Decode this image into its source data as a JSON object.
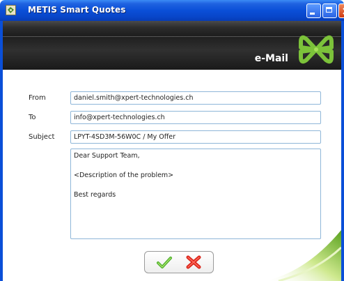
{
  "window": {
    "title": "METIS Smart Quotes"
  },
  "header": {
    "title": "e-Mail"
  },
  "form": {
    "from_label": "From",
    "from_value": "daniel.smith@xpert-technologies.ch",
    "to_label": "To",
    "to_value": "info@xpert-technologies.ch",
    "subject_label": "Subject",
    "subject_value": "LPYT-4SD3M-56W0C / My Offer",
    "body_lines": [
      "Dear Support Team,",
      "<Description of the problem>",
      "Best regards"
    ]
  },
  "icons": {
    "app": "metis-app-icon",
    "minimize": "minimize-icon",
    "maximize": "maximize-icon",
    "close": "close-icon",
    "ok": "checkmark-icon",
    "cancel": "red-x-icon",
    "logo": "green-clover-logo"
  },
  "colors": {
    "titlebar": "#0a4fd8",
    "header_band": "#1e1e1e",
    "input_border": "#8eb6d8",
    "logo_green": "#7cc23a",
    "ok_green": "#4caf2a",
    "cancel_red": "#d9261c"
  }
}
